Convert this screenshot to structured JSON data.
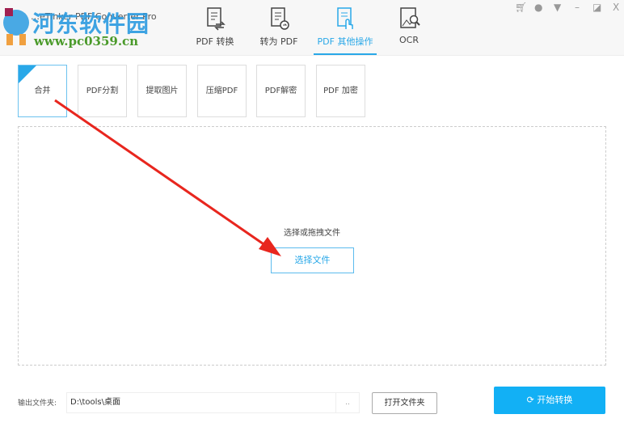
{
  "header": {
    "app_title": "…eTinker PDF Converter Pro",
    "watermark_name": "河东软件园",
    "watermark_url": "www.pc0359.cn",
    "tabs": [
      {
        "label": "PDF 转换",
        "icon": "pdf-convert-icon"
      },
      {
        "label": "转为 PDF",
        "icon": "to-pdf-icon"
      },
      {
        "label": "PDF 其他操作",
        "icon": "pdf-other-icon",
        "active": true
      },
      {
        "label": "OCR",
        "icon": "ocr-icon"
      }
    ],
    "window_controls": [
      "cart-icon",
      "user-icon",
      "menu-icon",
      "minimize-icon",
      "restore-icon",
      "close-icon"
    ]
  },
  "tools": [
    {
      "label": "合并",
      "selected": true
    },
    {
      "label": "PDF分割"
    },
    {
      "label": "提取图片"
    },
    {
      "label": "压缩PDF"
    },
    {
      "label": "PDF解密"
    },
    {
      "label": "PDF 加密"
    }
  ],
  "drop": {
    "hint": "选择或拖拽文件",
    "button": "选择文件"
  },
  "footer": {
    "output_label": "输出文件夹:",
    "output_path": "D:\\tools\\桌面",
    "browse": "..",
    "open_folder": "打开文件夹",
    "start": "开始转换"
  },
  "colors": {
    "accent": "#29a8e8",
    "start_button": "#12b0f5",
    "arrow": "#e8261e"
  }
}
